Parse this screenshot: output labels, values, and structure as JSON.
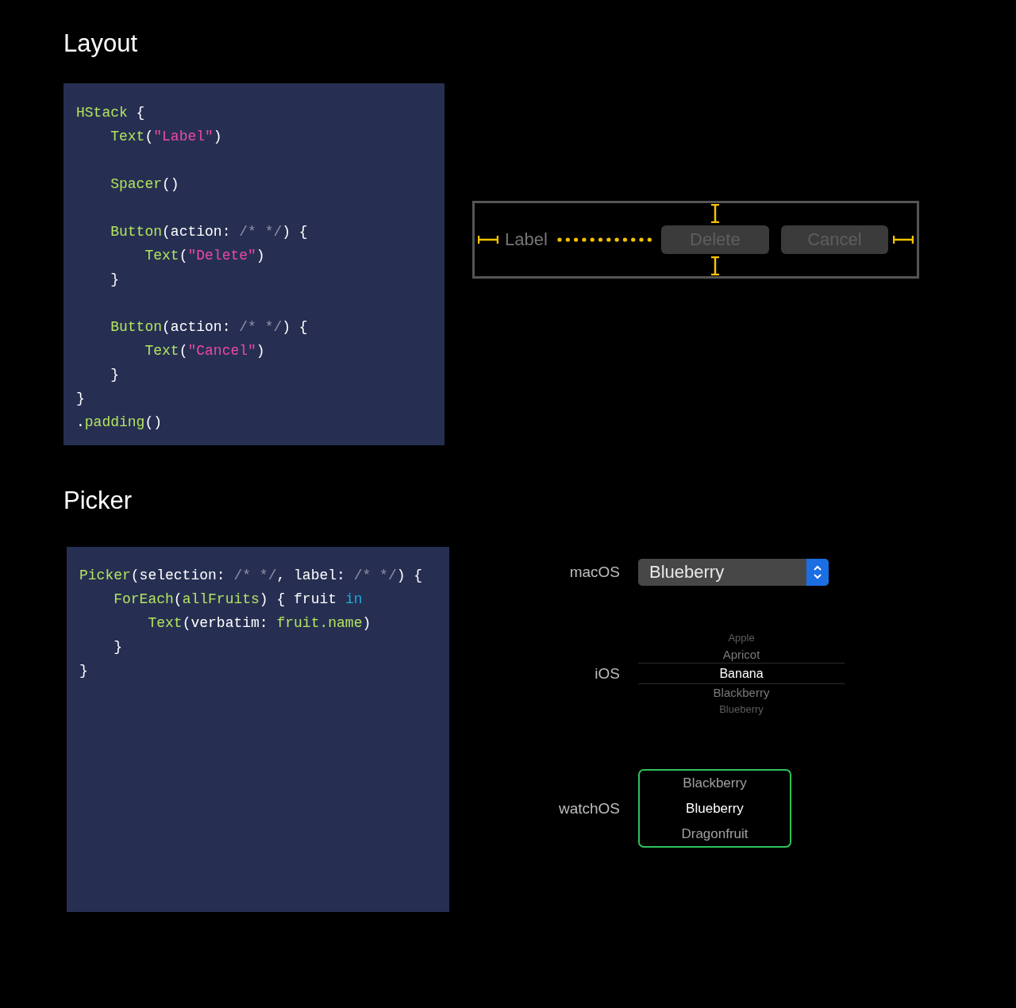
{
  "layout": {
    "title": "Layout",
    "code": [
      {
        "kind": "code",
        "tokens": [
          {
            "kind": "name",
            "text": "HStack"
          },
          {
            "kind": "plain",
            "text": " {"
          }
        ]
      },
      {
        "kind": "code",
        "tokens": [
          {
            "kind": "name",
            "text": "    Text"
          },
          {
            "kind": "plain",
            "text": "("
          },
          {
            "kind": "string",
            "text": "\"Label\""
          },
          {
            "kind": "plain",
            "text": ")"
          }
        ]
      },
      {
        "kind": "blank"
      },
      {
        "kind": "code",
        "tokens": [
          {
            "kind": "name",
            "text": "    Spacer"
          },
          {
            "kind": "plain",
            "text": "()"
          }
        ]
      },
      {
        "kind": "blank"
      },
      {
        "kind": "code",
        "tokens": [
          {
            "kind": "name",
            "text": "    Button"
          },
          {
            "kind": "plain",
            "text": "(action: "
          },
          {
            "kind": "comment",
            "text": "/* */"
          },
          {
            "kind": "plain",
            "text": ") {"
          }
        ]
      },
      {
        "kind": "code",
        "tokens": [
          {
            "kind": "name",
            "text": "        Text"
          },
          {
            "kind": "plain",
            "text": "("
          },
          {
            "kind": "string",
            "text": "\"Delete\""
          },
          {
            "kind": "plain",
            "text": ")"
          }
        ]
      },
      {
        "kind": "code",
        "tokens": [
          {
            "kind": "plain",
            "text": "    }"
          }
        ]
      },
      {
        "kind": "blank"
      },
      {
        "kind": "code",
        "tokens": [
          {
            "kind": "name",
            "text": "    Button"
          },
          {
            "kind": "plain",
            "text": "(action: "
          },
          {
            "kind": "comment",
            "text": "/* */"
          },
          {
            "kind": "plain",
            "text": ") {"
          }
        ]
      },
      {
        "kind": "code",
        "tokens": [
          {
            "kind": "name",
            "text": "        Text"
          },
          {
            "kind": "plain",
            "text": "("
          },
          {
            "kind": "string",
            "text": "\"Cancel\""
          },
          {
            "kind": "plain",
            "text": ")"
          }
        ]
      },
      {
        "kind": "code",
        "tokens": [
          {
            "kind": "plain",
            "text": "    }"
          }
        ]
      },
      {
        "kind": "code",
        "tokens": [
          {
            "kind": "plain",
            "text": "}"
          }
        ]
      },
      {
        "kind": "code",
        "tokens": [
          {
            "kind": "plain",
            "text": "."
          },
          {
            "kind": "name",
            "text": "padding"
          },
          {
            "kind": "plain",
            "text": "()"
          }
        ]
      }
    ],
    "preview": {
      "label": "Label",
      "buttons": [
        "Delete",
        "Cancel"
      ]
    }
  },
  "picker": {
    "title": "Picker",
    "code": [
      {
        "kind": "code",
        "tokens": [
          {
            "kind": "name",
            "text": "Picker"
          },
          {
            "kind": "plain",
            "text": "(selection: "
          },
          {
            "kind": "comment",
            "text": "/* */"
          },
          {
            "kind": "plain",
            "text": ", label: "
          },
          {
            "kind": "comment",
            "text": "/* */"
          },
          {
            "kind": "plain",
            "text": ") {"
          }
        ]
      },
      {
        "kind": "code",
        "tokens": [
          {
            "kind": "name",
            "text": "    ForEach"
          },
          {
            "kind": "plain",
            "text": "("
          },
          {
            "kind": "name",
            "text": "allFruits"
          },
          {
            "kind": "plain",
            "text": ") { fruit "
          },
          {
            "kind": "keyword",
            "text": "in"
          }
        ]
      },
      {
        "kind": "code",
        "tokens": [
          {
            "kind": "name",
            "text": "        Text"
          },
          {
            "kind": "plain",
            "text": "(verbatim: "
          },
          {
            "kind": "name",
            "text": "fruit.name"
          },
          {
            "kind": "plain",
            "text": ")"
          }
        ]
      },
      {
        "kind": "code",
        "tokens": [
          {
            "kind": "plain",
            "text": "    }"
          }
        ]
      },
      {
        "kind": "code",
        "tokens": [
          {
            "kind": "plain",
            "text": "}"
          }
        ]
      }
    ],
    "platforms": [
      {
        "name": "macOS",
        "kind": "popup",
        "value": "Blueberry"
      },
      {
        "name": "iOS",
        "kind": "wheel",
        "items": [
          {
            "text": "Apple",
            "selected": false
          },
          {
            "text": "Apricot",
            "selected": false
          },
          {
            "text": "Banana",
            "selected": true
          },
          {
            "text": "Blackberry",
            "selected": false
          },
          {
            "text": "Blueberry",
            "selected": false
          }
        ]
      },
      {
        "name": "watchOS",
        "kind": "crown",
        "items": [
          {
            "text": "Blackberry",
            "selected": false
          },
          {
            "text": "Blueberry",
            "selected": true
          },
          {
            "text": "Dragonfruit",
            "selected": false
          }
        ]
      }
    ]
  }
}
